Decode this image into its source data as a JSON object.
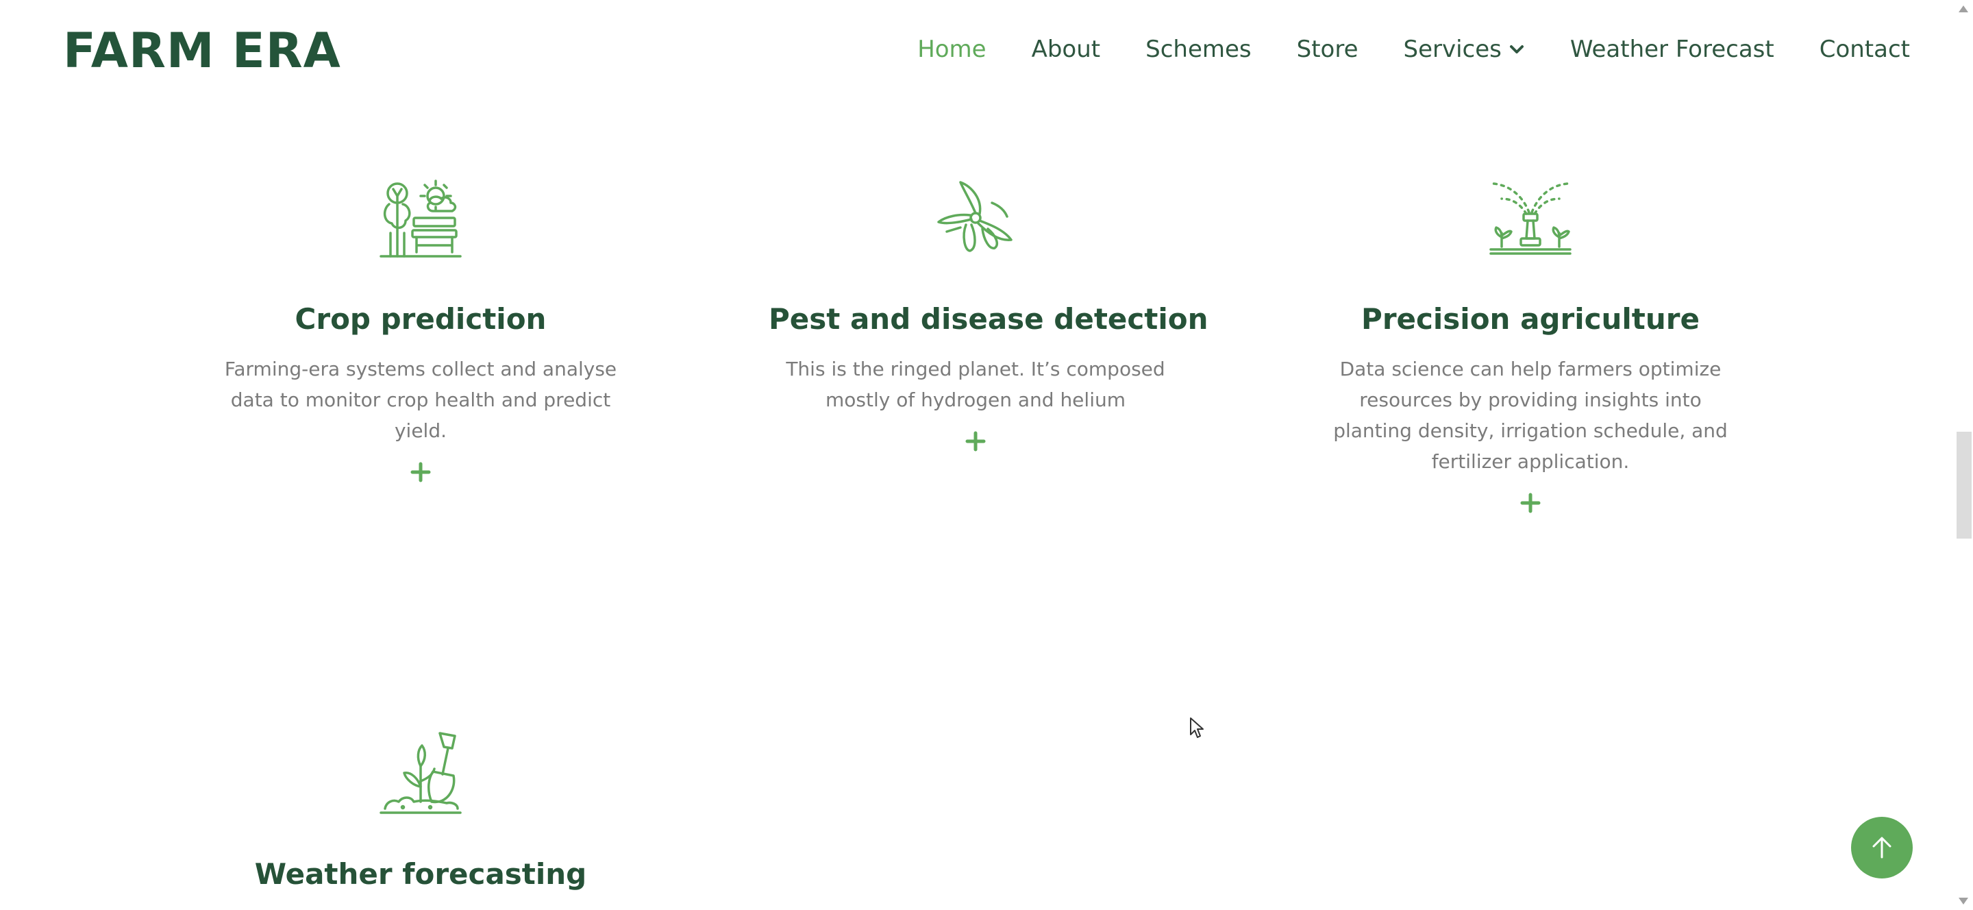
{
  "brand": {
    "logo": "FARM ERA"
  },
  "nav": {
    "home": "Home",
    "about": "About",
    "schemes": "Schemes",
    "store": "Store",
    "services": "Services",
    "weather_forecast": "Weather Forecast",
    "contact": "Contact",
    "active": "Home"
  },
  "services": [
    {
      "title": "Crop prediction",
      "description": "Farming-era systems collect and analyse data to monitor crop health and predict yield.",
      "icon": "park-tree-bench-icon"
    },
    {
      "title": "Pest and disease detection",
      "description": "This is the ringed planet. It’s composed mostly of hydrogen and helium",
      "icon": "pruning-shears-icon"
    },
    {
      "title": "Precision agriculture",
      "description": "Data science can help farmers optimize resources by providing insights into planting density, irrigation schedule, and fertilizer application.",
      "icon": "sprinkler-icon"
    },
    {
      "title": "Weather forecasting",
      "description": "",
      "icon": "shovel-sprout-icon"
    }
  ],
  "colors": {
    "brand_dark_green": "#24543a",
    "accent_green": "#5faa5a",
    "text_gray": "#7b7b7b"
  }
}
